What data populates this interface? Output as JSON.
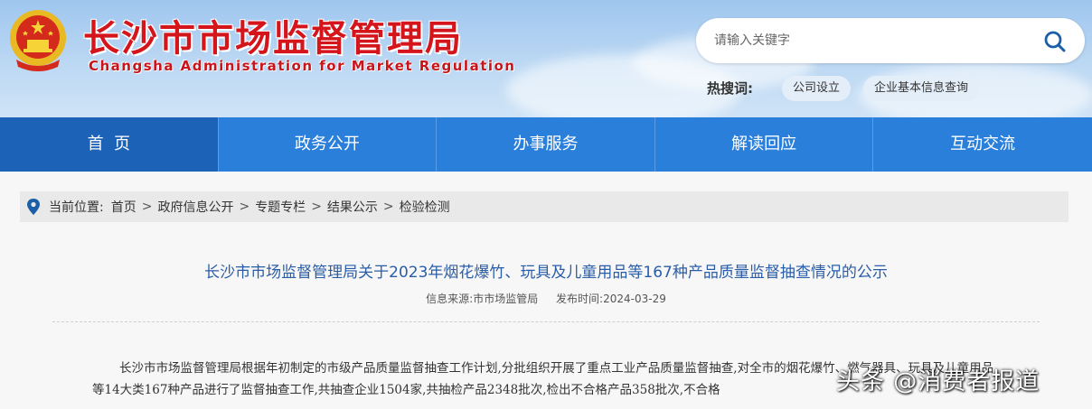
{
  "site": {
    "title_cn": "长沙市市场监督管理局",
    "title_en": "Changsha Administration for Market Regulation"
  },
  "search": {
    "placeholder": "请输入关键字"
  },
  "hot": {
    "label": "热搜词:",
    "tags": [
      "公司设立",
      "企业基本信息查询"
    ]
  },
  "nav": {
    "items": [
      {
        "label": "首  页",
        "active": true
      },
      {
        "label": "政务公开",
        "active": false
      },
      {
        "label": "办事服务",
        "active": false
      },
      {
        "label": "解读回应",
        "active": false
      },
      {
        "label": "互动交流",
        "active": false
      }
    ]
  },
  "breadcrumb": {
    "prefix": "当前位置:",
    "items": [
      "首页",
      "政府信息公开",
      "专题专栏",
      "结果公示",
      "检验检测"
    ],
    "separator": ">"
  },
  "article": {
    "title": "长沙市市场监督管理局关于2023年烟花爆竹、玩具及儿童用品等167种产品质量监督抽查情况的公示",
    "source_label": "信息来源:",
    "source": "市市场监管局",
    "date_label": "发布时间:",
    "date": "2024-03-29",
    "paragraph": "长沙市市场监督管理局根据年初制定的市级产品质量监督抽查工作计划,分批组织开展了重点工业产品质量监督抽查,对全市的烟花爆竹、燃气器具、玩具及儿童用品等14大类167种产品进行了监督抽查工作,共抽查企业1504家,共抽检产品2348批次,检出不合格产品358批次,不合格"
  },
  "watermark": "头条 @消费者报道",
  "colors": {
    "nav_bg": "#2a7fdb",
    "nav_active": "#1c63b8",
    "title_red": "#d4161c",
    "article_title": "#2a5da8"
  }
}
